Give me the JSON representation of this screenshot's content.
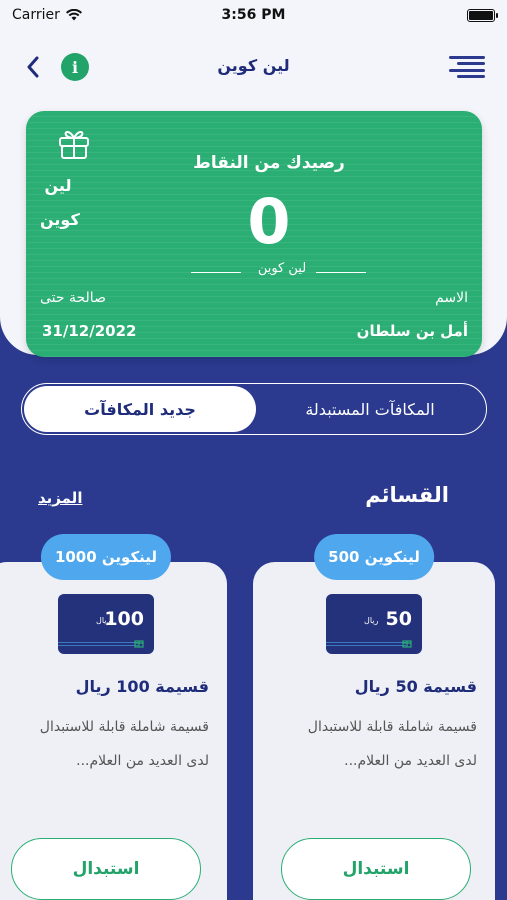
{
  "status": {
    "carrier": "Carrier",
    "time": "3:56 PM"
  },
  "nav": {
    "title": "لين كوين",
    "info_label": "i"
  },
  "card": {
    "brand_line1": "لين",
    "brand_line2": "كوين",
    "heading": "رصيدك من النقاط",
    "points": "0",
    "points_unit": "لين كوين",
    "name_label": "الاسم",
    "name_value": "أمل بن سلطان",
    "valid_label": "صالحة حتى",
    "valid_value": "31/12/2022"
  },
  "tabs": {
    "new_rewards": "جديد المكافآت",
    "redeemed_rewards": "المكافآت المستبدلة"
  },
  "section": {
    "title": "القسائم",
    "more": "المزيد"
  },
  "vouchers": [
    {
      "badge": "500 لينكوين",
      "amount": "50",
      "currency": "ريال",
      "title": "قسيمة 50 ريال",
      "desc": "قسيمة شاملة قابلة للاستبدال لدى العديد من العلام...",
      "button": "استبدال"
    },
    {
      "badge": "1000 لينكوين",
      "amount": "100",
      "currency": "ريال",
      "title": "قسيمة 100 ريال",
      "desc": "قسيمة شاملة قابلة للاستبدال لدى العديد من العلام...",
      "button": "استبدال"
    }
  ],
  "colors": {
    "primary": "#2b3a8f",
    "green": "#2aae74",
    "badge_blue": "#4fa7ee"
  }
}
